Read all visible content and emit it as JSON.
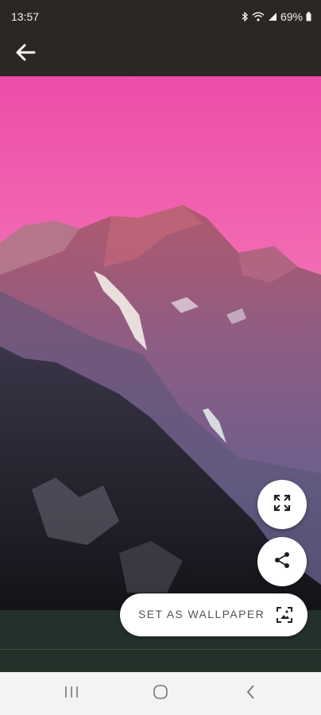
{
  "status_bar": {
    "time": "13:57",
    "battery": "69%"
  },
  "app_bar": {
    "back_icon": "arrow-left-icon"
  },
  "wallpaper": {
    "subject": "mountain-photo"
  },
  "actions": {
    "fullscreen_icon": "fullscreen-icon",
    "share_icon": "share-icon",
    "set_wallpaper_label": "SET AS WALLPAPER",
    "set_wallpaper_icon": "wallpaper-icon"
  },
  "nav_bar": {
    "recents": "recents-icon",
    "home": "home-icon",
    "back": "back-icon"
  },
  "colors": {
    "bar": "#2b2725",
    "footer": "#24312a",
    "sky_top": "#ef4fb0",
    "sky_bottom": "#f6a8a8"
  }
}
